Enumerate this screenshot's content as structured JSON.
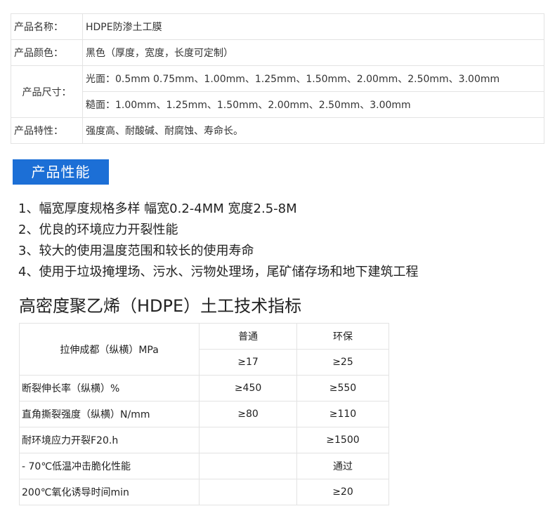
{
  "product_info": {
    "name_label": "产品名称：",
    "name_value": "HDPE防渗土工膜",
    "color_label": "产品颜色：",
    "color_value": "黑色（厚度，宽度，长度可定制）",
    "size_label": "产品尺寸：",
    "size_smooth": "光面：0.5mm 0.75mm、1.00mm、1.25mm、1.50mm、2.00mm、2.50mm、3.00mm",
    "size_rough": "糙面：1.00mm、1.25mm、1.50mm、2.00mm、2.50mm、3.00mm",
    "feature_label": "产品特性：",
    "feature_value": "强度高、耐酸碱、耐腐蚀、寿命长。"
  },
  "banner": {
    "title": "产品性能",
    "color": "#1c6fd6"
  },
  "features": [
    "1、幅宽厚度规格多样  幅宽0.2-4MM 宽度2.5-8M",
    "2、优良的环境应力开裂性能",
    "3、较大的使用温度范围和较长的使用寿命",
    "4、使用于垃圾掩埋场、污水、污物处理场，尾矿储存场和地下建筑工程"
  ],
  "tech_heading": "高密度聚乙烯（HDPE）土工技术指标",
  "spec_table": {
    "tensile_label": "拉伸成都（纵横）MPa",
    "header_col2": "普通",
    "header_col3": "环保",
    "tensile_col2": "≥17",
    "tensile_col3": "≥25",
    "rows": [
      {
        "label": "断裂伸长率（纵横）%",
        "col2": "≥450",
        "col3": "≥550"
      },
      {
        "label": "直角撕裂强度（纵横）N/mm",
        "col2": "≥80",
        "col3": "≥110"
      },
      {
        "label": "耐环境应力开裂F20.h",
        "col2": "",
        "col3": "≥1500"
      },
      {
        "label": " - 70℃低温冲击脆化性能",
        "col2": "",
        "col3": "通过"
      },
      {
        "label": "200℃氧化诱导时间min",
        "col2": "",
        "col3": "≥20"
      }
    ]
  }
}
